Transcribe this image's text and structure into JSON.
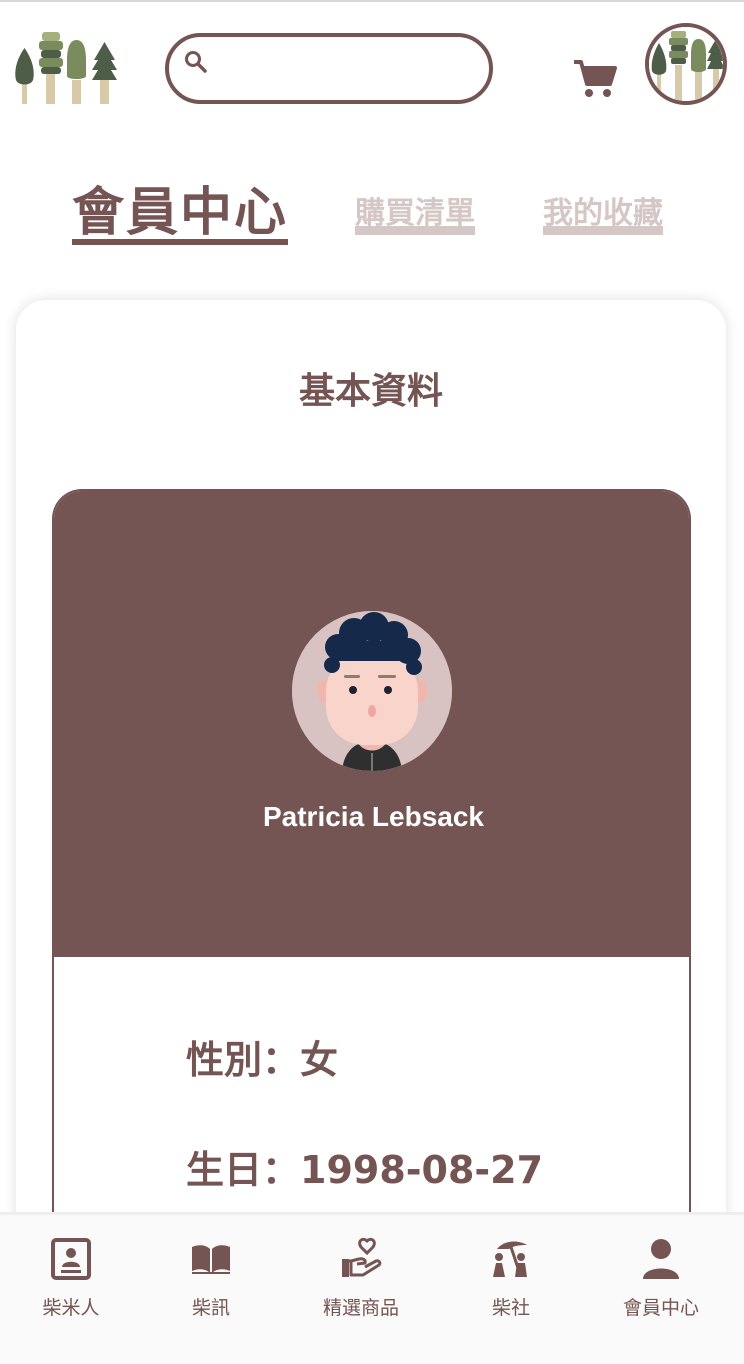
{
  "header": {
    "logo_icon": "trees-logo-icon",
    "search_placeholder": "",
    "search_icon": "search-icon",
    "cart_icon": "cart-icon",
    "avatar_icon": "trees-avatar-icon"
  },
  "tabs": [
    {
      "label": "會員中心",
      "active": true
    },
    {
      "label": "購買清單",
      "active": false
    },
    {
      "label": "我的收藏",
      "active": false
    }
  ],
  "card": {
    "title": "基本資料",
    "member": {
      "name": "Patricia Lebsack",
      "avatar_icon": "member-avatar-icon"
    },
    "info": [
      {
        "text": "性別：女"
      },
      {
        "text": "生日：1998-08-27"
      }
    ]
  },
  "bottom_nav": [
    {
      "label": "柴米人",
      "icon": "contact-card-icon"
    },
    {
      "label": "柴訊",
      "icon": "book-icon"
    },
    {
      "label": "精選商品",
      "icon": "hand-heart-icon"
    },
    {
      "label": "柴社",
      "icon": "community-icon"
    },
    {
      "label": "會員中心",
      "icon": "user-icon"
    }
  ],
  "colors": {
    "primary": "#745553",
    "muted": "#d5c7c5",
    "tree_dark": "#4e5d48",
    "tree_green": "#7a8c5e",
    "trunk": "#d8c9a8"
  }
}
